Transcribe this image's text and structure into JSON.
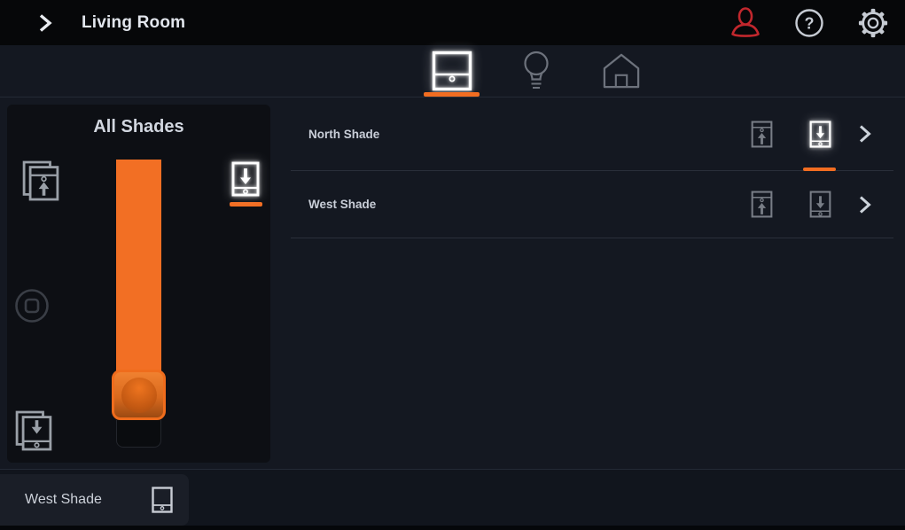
{
  "colors": {
    "accent": "#F26D21",
    "profile_red": "#C1272D",
    "background": "#141821",
    "card": "#0D0F14"
  },
  "top_bar": {
    "title": "Living Room",
    "icons": [
      "forward-chevron",
      "profile",
      "help",
      "settings"
    ]
  },
  "tab_bar": {
    "tabs": [
      {
        "id": "shades",
        "icon": "shade-icon",
        "active": true
      },
      {
        "id": "lights",
        "icon": "bulb-icon",
        "active": false
      },
      {
        "id": "home",
        "icon": "home-icon",
        "active": false
      }
    ]
  },
  "all_shades_panel": {
    "title": "All Shades",
    "controls": {
      "raise_all": "raise-all-shades",
      "stop": "stop",
      "lower_all": "lower-all-shades",
      "active_action": "lower"
    },
    "slider": {
      "orientation": "vertical",
      "fill_percent": 82
    }
  },
  "shade_list": {
    "rows": [
      {
        "label": "North Shade",
        "active_action": "lower"
      },
      {
        "label": "West Shade",
        "active_action": null
      }
    ]
  },
  "bottom_bar": {
    "selected_label": "West Shade"
  }
}
